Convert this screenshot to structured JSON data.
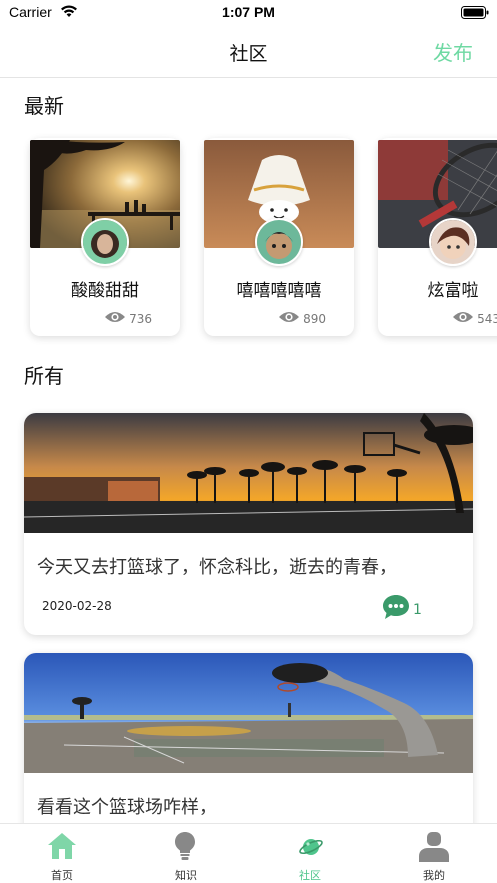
{
  "status_bar": {
    "carrier": "Carrier",
    "time": "1:07 PM"
  },
  "nav": {
    "title": "社区",
    "publish_label": "发布"
  },
  "sections": {
    "latest": "最新",
    "all": "所有"
  },
  "latest_posts": [
    {
      "name": "酸酸甜甜",
      "views": "736"
    },
    {
      "name": "嘻嘻嘻嘻嘻",
      "views": "890"
    },
    {
      "name": "炫富啦",
      "views": "543"
    }
  ],
  "all_posts": [
    {
      "text": "今天又去打篮球了，怀念科比，逝去的青春，",
      "date": "2020-02-28",
      "comments": "1"
    },
    {
      "text": "看看这个篮球场咋样，"
    }
  ],
  "tabs": [
    {
      "label": "首页",
      "active": false
    },
    {
      "label": "知识",
      "active": false
    },
    {
      "label": "社区",
      "active": true
    },
    {
      "label": "我的",
      "active": false
    }
  ],
  "colors": {
    "accent": "#4fc58c",
    "publish": "#6fd9a3"
  }
}
